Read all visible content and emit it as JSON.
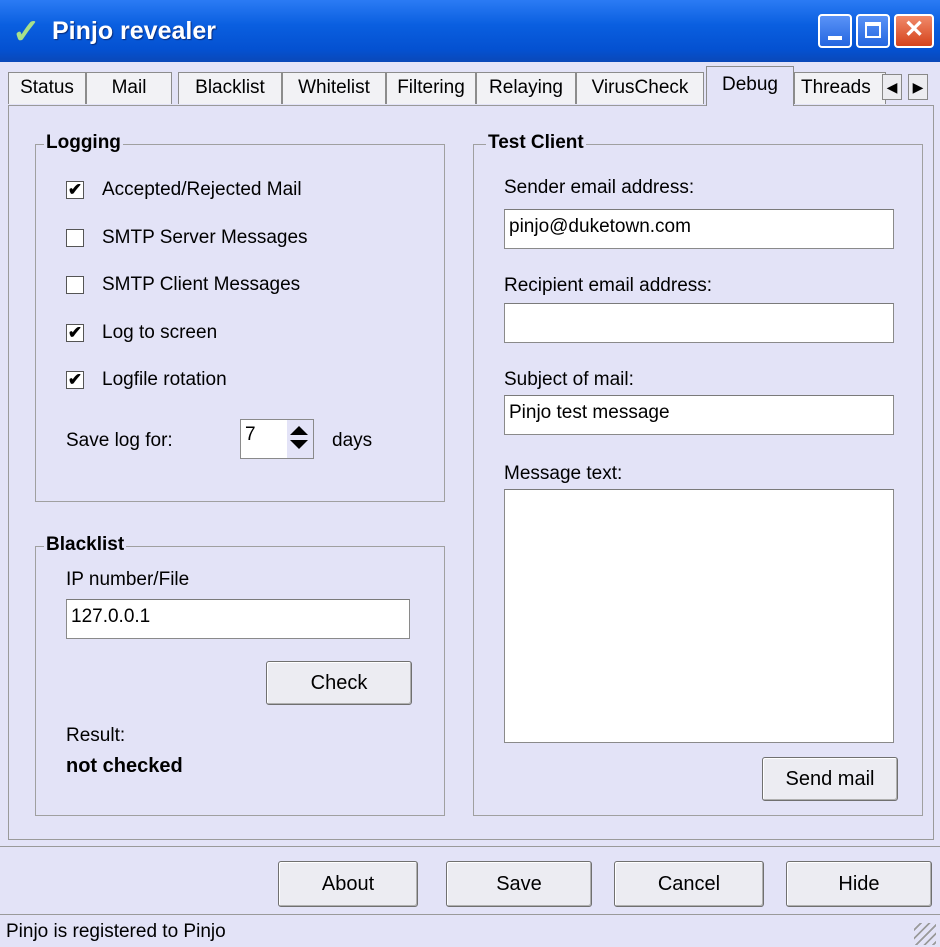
{
  "window": {
    "title": "Pinjo revealer"
  },
  "tabs": [
    "Status",
    "Mail",
    "Blacklist",
    "Whitelist",
    "Filtering",
    "Relaying",
    "VirusCheck",
    "Debug",
    "Threads"
  ],
  "active_tab": "Debug",
  "logging": {
    "title": "Logging",
    "options": [
      {
        "label": "Accepted/Rejected Mail",
        "checked": true
      },
      {
        "label": "SMTP Server Messages",
        "checked": false
      },
      {
        "label": "SMTP Client Messages",
        "checked": false
      },
      {
        "label": "Log to screen",
        "checked": true
      },
      {
        "label": "Logfile rotation",
        "checked": true
      }
    ],
    "save_log_label": "Save log for:",
    "save_log_value": "7",
    "days_label": "days"
  },
  "blacklist": {
    "title": "Blacklist",
    "ip_label": "IP number/File",
    "ip_value": "127.0.0.1",
    "check_button": "Check",
    "result_label": "Result:",
    "result_value": "not checked"
  },
  "test_client": {
    "title": "Test Client",
    "sender_label": "Sender email address:",
    "sender_value": "pinjo@duketown.com",
    "recipient_label": "Recipient email address:",
    "recipient_value": "",
    "subject_label": "Subject of mail:",
    "subject_value": "Pinjo test message",
    "message_label": "Message text:",
    "message_value": "",
    "send_button": "Send mail"
  },
  "buttons": {
    "about": "About",
    "save": "Save",
    "cancel": "Cancel",
    "hide": "Hide"
  },
  "status_bar": {
    "text": "Pinjo is registered to Pinjo"
  }
}
